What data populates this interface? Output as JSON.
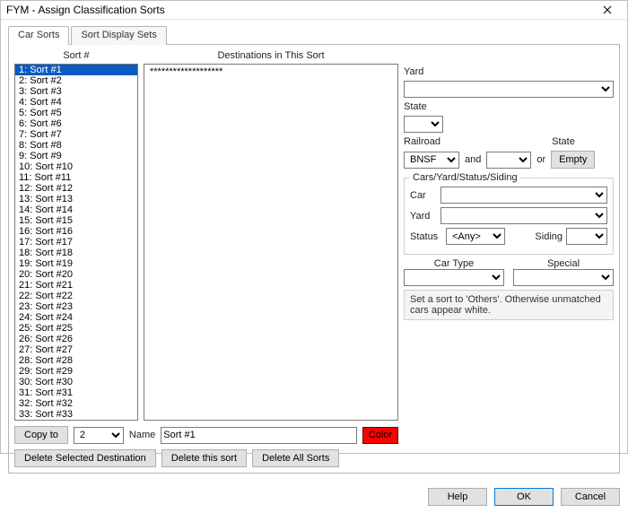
{
  "window": {
    "title": "FYM - Assign Classification Sorts"
  },
  "tabs": [
    {
      "label": "Car Sorts",
      "active": true
    },
    {
      "label": "Sort Display Sets",
      "active": false
    }
  ],
  "headers": {
    "sort_number": "Sort #",
    "destinations": "Destinations in This Sort"
  },
  "sort_list": [
    "1: Sort #1",
    "2: Sort #2",
    "3: Sort #3",
    "4: Sort #4",
    "5: Sort #5",
    "6: Sort #6",
    "7: Sort #7",
    "8: Sort #8",
    "9: Sort #9",
    "10: Sort #10",
    "11: Sort #11",
    "12: Sort #12",
    "13: Sort #13",
    "14: Sort #14",
    "15: Sort #15",
    "16: Sort #16",
    "17: Sort #17",
    "18: Sort #18",
    "19: Sort #19",
    "20: Sort #20",
    "21: Sort #21",
    "22: Sort #22",
    "23: Sort #23",
    "24: Sort #24",
    "25: Sort #25",
    "26: Sort #26",
    "27: Sort #27",
    "28: Sort #28",
    "29: Sort #29",
    "30: Sort #30",
    "31: Sort #31",
    "32: Sort #32",
    "33: Sort #33"
  ],
  "selected_sort_index": 0,
  "destinations_text": "*******************",
  "right": {
    "yard_label": "Yard",
    "state_label": "State",
    "railroad_label": "Railroad",
    "railroad_value": "BNSF",
    "and_label": "and",
    "or_label": "or",
    "empty_button": "Empty",
    "group_label": "Cars/Yard/Status/Siding",
    "car_label": "Car",
    "yard2_label": "Yard",
    "status_label": "Status",
    "status_value": "<Any>",
    "siding_label": "Siding",
    "cartype_label": "Car Type",
    "special_label": "Special",
    "hint": "Set a sort to 'Others'. Otherwise unmatched cars appear white."
  },
  "bottom": {
    "copy_to": "Copy to",
    "copy_value": "2",
    "name_label": "Name",
    "name_value": "Sort #1",
    "color_label": "Color",
    "delete_dest": "Delete Selected Destination",
    "delete_sort": "Delete this sort",
    "delete_all": "Delete All Sorts"
  },
  "dialog": {
    "help": "Help",
    "ok": "OK",
    "cancel": "Cancel"
  }
}
